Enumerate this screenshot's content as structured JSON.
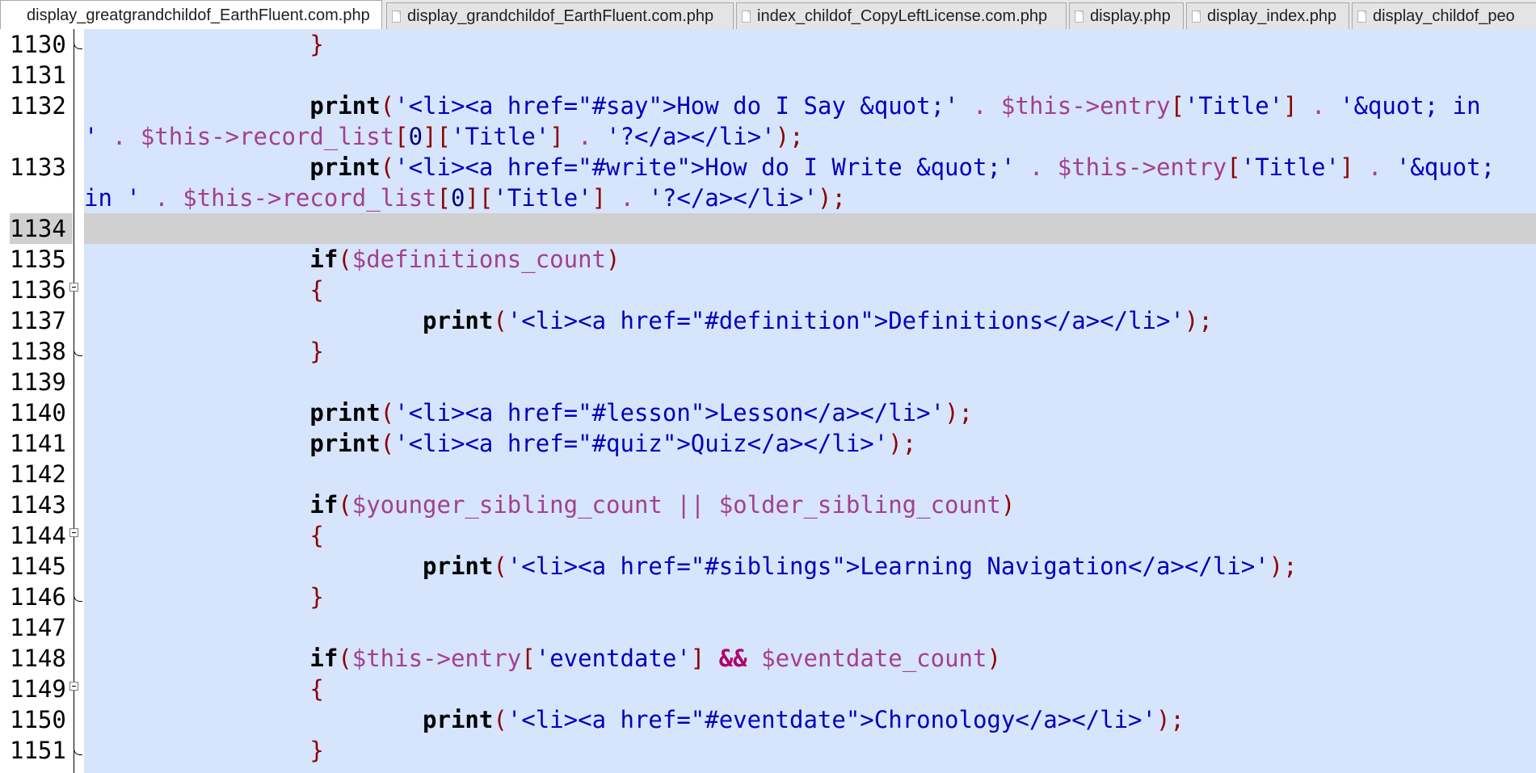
{
  "tabs": [
    {
      "label": "display_greatgrandchildof_EarthFluent.com.php",
      "active": true
    },
    {
      "label": "display_grandchildof_EarthFluent.com.php",
      "active": false
    },
    {
      "label": "index_childof_CopyLeftLicense.com.php",
      "active": false
    },
    {
      "label": "display.php",
      "active": false
    },
    {
      "label": "display_index.php",
      "active": false
    },
    {
      "label": "display_childof_peo",
      "active": false
    }
  ],
  "line_numbers": [
    "1130",
    "1131",
    "1132",
    "",
    "1133",
    "",
    "1134",
    "1135",
    "1136",
    "1137",
    "1138",
    "1139",
    "1140",
    "1141",
    "1142",
    "1143",
    "1144",
    "1145",
    "1146",
    "1147",
    "1148",
    "1149",
    "1150",
    "1151"
  ],
  "current_line": "1134",
  "code": {
    "indent1": "                ",
    "indent2": "                        ",
    "brace_close": "}",
    "brace_open": "{",
    "print": "print",
    "if": "if",
    "lp": "(",
    "rp": ")",
    "semi": ";",
    "dot": " . ",
    "lb": "[",
    "rb": "]",
    "this_entry": "$this->entry",
    "this_record_list": "$this->record_list",
    "zero": "0",
    "q_title": "'Title'",
    "q_eventdate": "'eventdate'",
    "l1132_s1": "'<li><a href=\"#say\">How do I Say &quot;'",
    "l1132_s2": "'&quot; in",
    "l1132_s2b": "'",
    "l1132_s3": "'?</a></li>'",
    "l1133_s1": "'<li><a href=\"#write\">How do I Write &quot;'",
    "l1133_s2": "'&quot;",
    "l1133_s2b": "in '",
    "l1133_s3": "'?</a></li>'",
    "definitions_count": "$definitions_count",
    "l1137_s": "'<li><a href=\"#definition\">Definitions</a></li>'",
    "l1140_s": "'<li><a href=\"#lesson\">Lesson</a></li>'",
    "l1141_s": "'<li><a href=\"#quiz\">Quiz</a></li>'",
    "younger_sibling_count": "$younger_sibling_count",
    "or_op": " || ",
    "older_sibling_count": "$older_sibling_count",
    "l1145_s": "'<li><a href=\"#siblings\">Learning Navigation</a></li>'",
    "and_op": " && ",
    "eventdate_count": "$eventdate_count",
    "l1150_s": "'<li><a href=\"#eventdate\">Chronology</a></li>'"
  }
}
